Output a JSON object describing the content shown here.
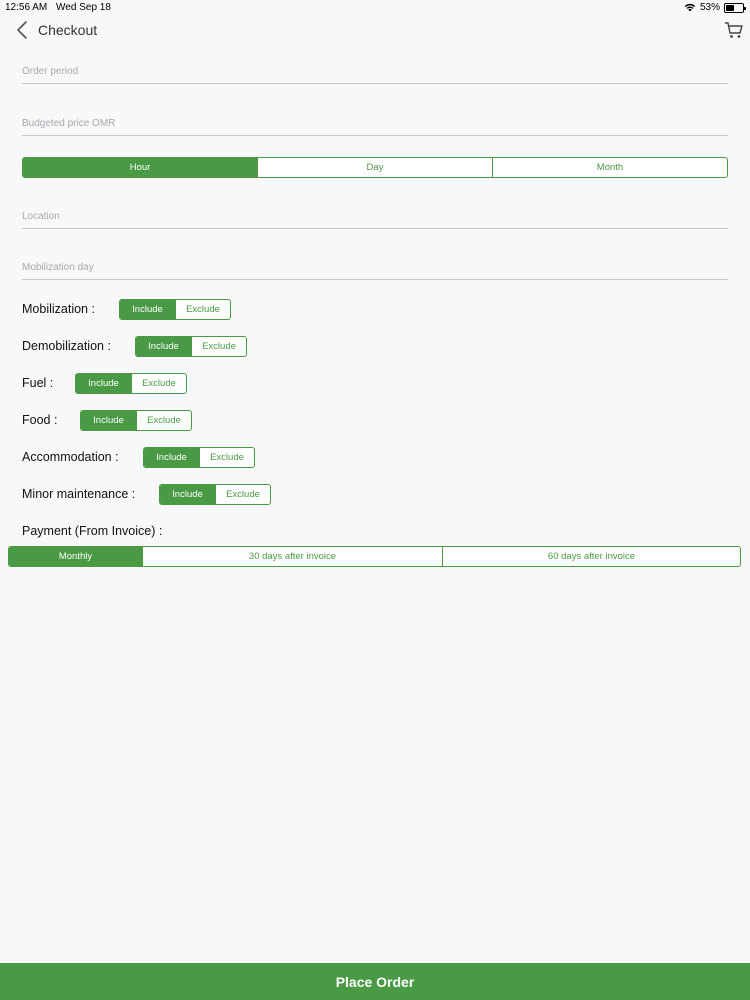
{
  "status_bar": {
    "time": "12:56 AM",
    "date": "Wed Sep 18",
    "battery_percent": "53%",
    "battery_level": 0.53
  },
  "nav": {
    "title": "Checkout",
    "back_icon": "chevron-left-icon",
    "cart_icon": "cart-icon"
  },
  "fields": {
    "order_period": "Order period",
    "budgeted_price": "Budgeted price OMR",
    "location": "Location",
    "mobilization_day": "Mobilization day"
  },
  "period_segment": {
    "options": [
      "Hour",
      "Day",
      "Month"
    ],
    "selected": "Hour"
  },
  "toggles": [
    {
      "label": "Mobilization  :",
      "include": "Include",
      "exclude": "Exclude",
      "selected": "Include"
    },
    {
      "label": "Demobilization  :",
      "include": "Include",
      "exclude": "Exclude",
      "selected": "Include"
    },
    {
      "label": "Fuel  :",
      "include": "Include",
      "exclude": "Exclude",
      "selected": "Include"
    },
    {
      "label": "Food  :",
      "include": "Include",
      "exclude": "Exclude",
      "selected": "Include"
    },
    {
      "label": "Accommodation  :",
      "include": "Include",
      "exclude": "Exclude",
      "selected": "Include"
    },
    {
      "label": "Minor maintenance  :",
      "include": "Include",
      "exclude": "Exclude",
      "selected": "Include"
    }
  ],
  "payment": {
    "label": "Payment (From Invoice)  :",
    "options": [
      "Monthly",
      "30 days after invoice",
      "60 days after invoice"
    ],
    "selected": "Monthly"
  },
  "place_order": "Place Order",
  "colors": {
    "accent": "#4a9a45",
    "background": "#f8f8fb"
  }
}
